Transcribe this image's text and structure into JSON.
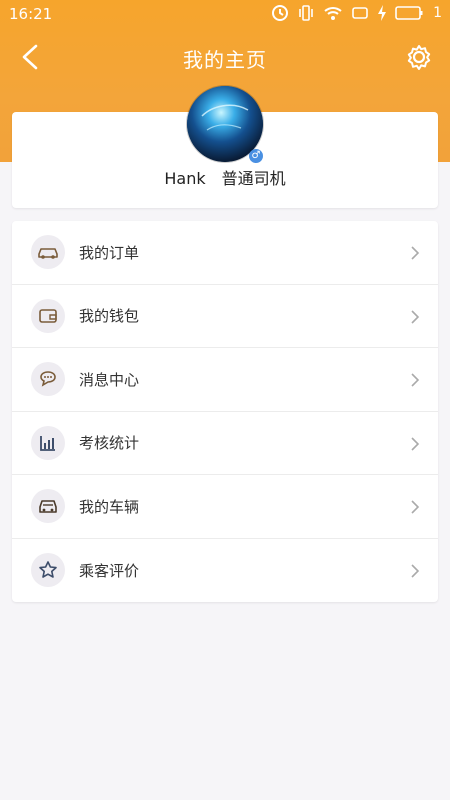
{
  "statusbar": {
    "time": "16:21",
    "battery": "1"
  },
  "header": {
    "title": "我的主页"
  },
  "profile": {
    "name": "Hank",
    "role": "普通司机",
    "gender_symbol": "♂"
  },
  "menu": {
    "items": [
      {
        "label": "我的订单",
        "icon": "car-icon"
      },
      {
        "label": "我的钱包",
        "icon": "wallet-icon"
      },
      {
        "label": "消息中心",
        "icon": "chat-icon"
      },
      {
        "label": "考核统计",
        "icon": "stats-icon"
      },
      {
        "label": "我的车辆",
        "icon": "vehicle-icon"
      },
      {
        "label": "乘客评价",
        "icon": "star-icon"
      }
    ]
  },
  "colors": {
    "accent": "#f6a52c",
    "background": "#f6f5f8"
  }
}
